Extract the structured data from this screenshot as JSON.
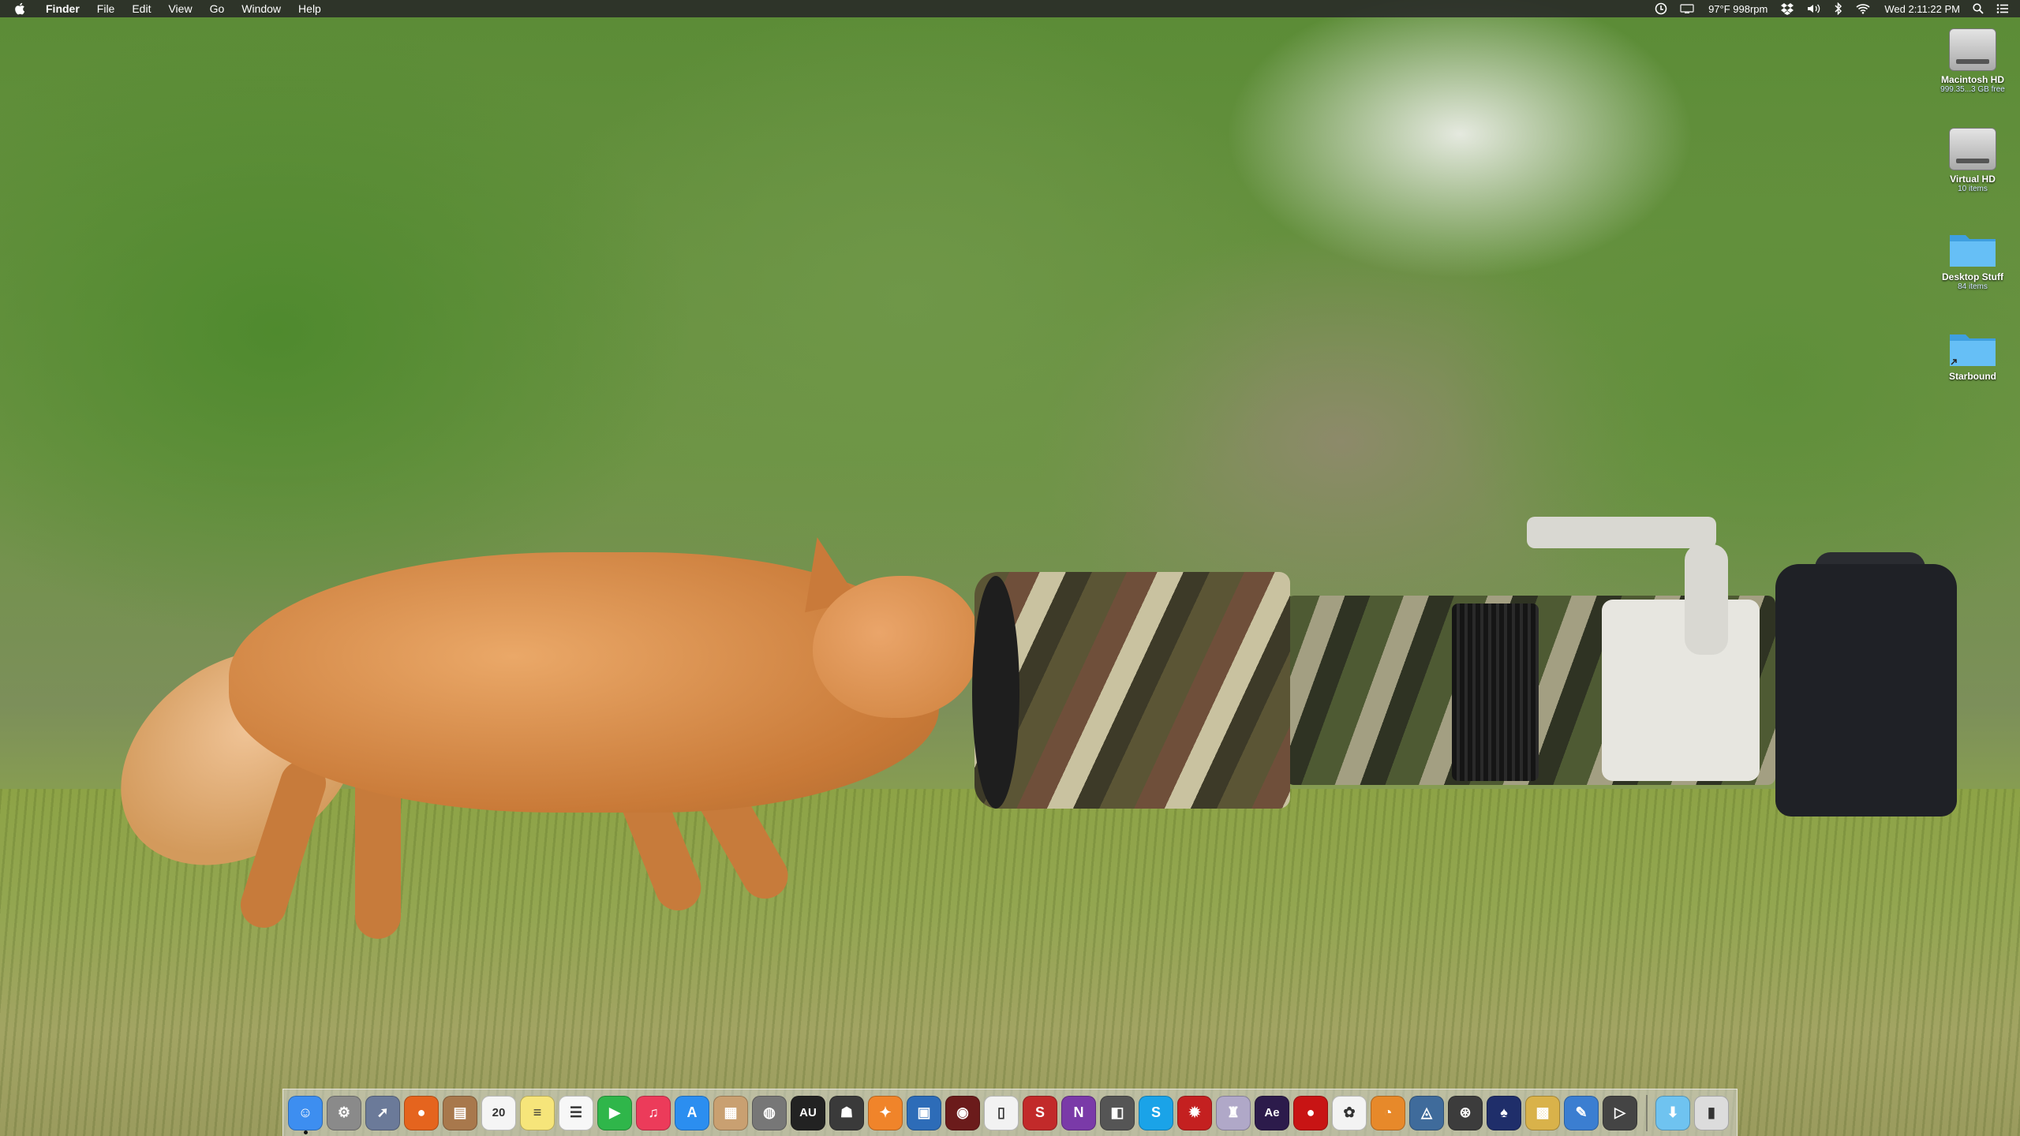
{
  "menubar": {
    "app_name": "Finder",
    "menus": [
      "File",
      "Edit",
      "View",
      "Go",
      "Window",
      "Help"
    ],
    "status": {
      "temp_fan": "97°F 998rpm",
      "clock": "Wed 2:11:22 PM"
    },
    "icons": [
      "battery-status-icon",
      "display-icon",
      "dropbox-icon",
      "volume-icon",
      "bluetooth-icon",
      "wifi-icon",
      "spotlight-icon",
      "notification-center-icon"
    ]
  },
  "desktop": {
    "items": [
      {
        "name": "Macintosh HD",
        "sub": "999.35...3 GB free",
        "kind": "hard-drive"
      },
      {
        "name": "Virtual HD",
        "sub": "10 items",
        "kind": "hard-drive"
      },
      {
        "name": "Desktop Stuff",
        "sub": "84 items",
        "kind": "folder"
      },
      {
        "name": "Starbound",
        "sub": "",
        "kind": "folder"
      }
    ]
  },
  "dock": {
    "apps": [
      {
        "name": "finder",
        "color": "#3d8ef0",
        "glyph": "☺",
        "running": true
      },
      {
        "name": "system-preferences",
        "color": "#8a8a8a",
        "glyph": "⚙"
      },
      {
        "name": "launchpad",
        "color": "#6b7a99",
        "glyph": "➚"
      },
      {
        "name": "firefox",
        "color": "#e5641e",
        "glyph": "●"
      },
      {
        "name": "contacts",
        "color": "#a8784c",
        "glyph": "▤"
      },
      {
        "name": "calendar",
        "color": "#f5f5f5",
        "glyph": "20"
      },
      {
        "name": "notes",
        "color": "#f6e57a",
        "glyph": "≡"
      },
      {
        "name": "reminders",
        "color": "#f7f7f7",
        "glyph": "☰"
      },
      {
        "name": "facetime",
        "color": "#2fb64a",
        "glyph": "▶"
      },
      {
        "name": "itunes",
        "color": "#ec3b5a",
        "glyph": "♫"
      },
      {
        "name": "app-store",
        "color": "#2b8ef0",
        "glyph": "A"
      },
      {
        "name": "preview",
        "color": "#c9a071",
        "glyph": "▦"
      },
      {
        "name": "disk-utility",
        "color": "#777777",
        "glyph": "◍"
      },
      {
        "name": "audio-unit",
        "color": "#222222",
        "glyph": "AU"
      },
      {
        "name": "alfred",
        "color": "#3a3a3a",
        "glyph": "☗"
      },
      {
        "name": "blender",
        "color": "#f0842a",
        "glyph": "✦"
      },
      {
        "name": "virtualbox",
        "color": "#2d6cb8",
        "glyph": "▣"
      },
      {
        "name": "night-owl",
        "color": "#6b1b1b",
        "glyph": "◉"
      },
      {
        "name": "document",
        "color": "#f2f2f2",
        "glyph": "▯"
      },
      {
        "name": "scrivener",
        "color": "#c22a2a",
        "glyph": "S"
      },
      {
        "name": "onenote",
        "color": "#7a3aa8",
        "glyph": "N"
      },
      {
        "name": "photo-booth",
        "color": "#555555",
        "glyph": "◧"
      },
      {
        "name": "skype",
        "color": "#1aa3e8",
        "glyph": "S"
      },
      {
        "name": "mono-game",
        "color": "#c42020",
        "glyph": "✹"
      },
      {
        "name": "automator",
        "color": "#b0a8c8",
        "glyph": "♜"
      },
      {
        "name": "after-effects",
        "color": "#2c1b4b",
        "glyph": "Ae"
      },
      {
        "name": "record-button",
        "color": "#c81414",
        "glyph": "●"
      },
      {
        "name": "photos",
        "color": "#f3f3f3",
        "glyph": "✿"
      },
      {
        "name": "logic",
        "color": "#e7892a",
        "glyph": "◔"
      },
      {
        "name": "time-machine",
        "color": "#3f6b9b",
        "glyph": "◬"
      },
      {
        "name": "steam",
        "color": "#3c3c3c",
        "glyph": "⊛"
      },
      {
        "name": "clean-my-mac",
        "color": "#1f2e6a",
        "glyph": "♠"
      },
      {
        "name": "archive-utility",
        "color": "#d9b24a",
        "glyph": "▩"
      },
      {
        "name": "xcode",
        "color": "#3b7ed1",
        "glyph": "✎"
      },
      {
        "name": "final-cut",
        "color": "#444444",
        "glyph": "▷"
      }
    ],
    "trailing": [
      {
        "name": "downloads-folder",
        "color": "#6fc3f0",
        "glyph": "⬇"
      },
      {
        "name": "trash",
        "color": "#dcdcdc",
        "glyph": "▮"
      }
    ]
  },
  "colors": {
    "menubar_bg": "#282828",
    "folder_blue": "#5fb8f5"
  }
}
